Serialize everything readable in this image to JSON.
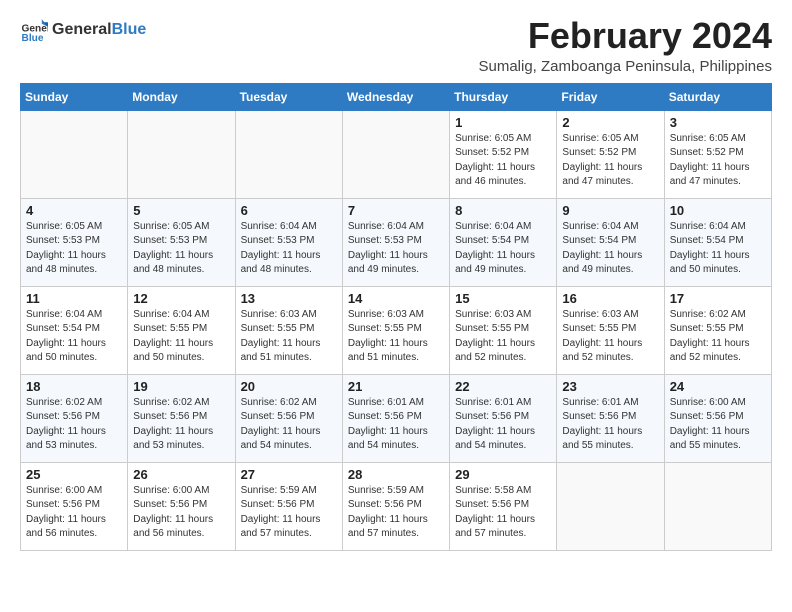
{
  "header": {
    "logo_general": "General",
    "logo_blue": "Blue",
    "month_year": "February 2024",
    "location": "Sumalig, Zamboanga Peninsula, Philippines"
  },
  "weekdays": [
    "Sunday",
    "Monday",
    "Tuesday",
    "Wednesday",
    "Thursday",
    "Friday",
    "Saturday"
  ],
  "weeks": [
    [
      {
        "day": "",
        "info": ""
      },
      {
        "day": "",
        "info": ""
      },
      {
        "day": "",
        "info": ""
      },
      {
        "day": "",
        "info": ""
      },
      {
        "day": "1",
        "info": "Sunrise: 6:05 AM\nSunset: 5:52 PM\nDaylight: 11 hours\nand 46 minutes."
      },
      {
        "day": "2",
        "info": "Sunrise: 6:05 AM\nSunset: 5:52 PM\nDaylight: 11 hours\nand 47 minutes."
      },
      {
        "day": "3",
        "info": "Sunrise: 6:05 AM\nSunset: 5:52 PM\nDaylight: 11 hours\nand 47 minutes."
      }
    ],
    [
      {
        "day": "4",
        "info": "Sunrise: 6:05 AM\nSunset: 5:53 PM\nDaylight: 11 hours\nand 48 minutes."
      },
      {
        "day": "5",
        "info": "Sunrise: 6:05 AM\nSunset: 5:53 PM\nDaylight: 11 hours\nand 48 minutes."
      },
      {
        "day": "6",
        "info": "Sunrise: 6:04 AM\nSunset: 5:53 PM\nDaylight: 11 hours\nand 48 minutes."
      },
      {
        "day": "7",
        "info": "Sunrise: 6:04 AM\nSunset: 5:53 PM\nDaylight: 11 hours\nand 49 minutes."
      },
      {
        "day": "8",
        "info": "Sunrise: 6:04 AM\nSunset: 5:54 PM\nDaylight: 11 hours\nand 49 minutes."
      },
      {
        "day": "9",
        "info": "Sunrise: 6:04 AM\nSunset: 5:54 PM\nDaylight: 11 hours\nand 49 minutes."
      },
      {
        "day": "10",
        "info": "Sunrise: 6:04 AM\nSunset: 5:54 PM\nDaylight: 11 hours\nand 50 minutes."
      }
    ],
    [
      {
        "day": "11",
        "info": "Sunrise: 6:04 AM\nSunset: 5:54 PM\nDaylight: 11 hours\nand 50 minutes."
      },
      {
        "day": "12",
        "info": "Sunrise: 6:04 AM\nSunset: 5:55 PM\nDaylight: 11 hours\nand 50 minutes."
      },
      {
        "day": "13",
        "info": "Sunrise: 6:03 AM\nSunset: 5:55 PM\nDaylight: 11 hours\nand 51 minutes."
      },
      {
        "day": "14",
        "info": "Sunrise: 6:03 AM\nSunset: 5:55 PM\nDaylight: 11 hours\nand 51 minutes."
      },
      {
        "day": "15",
        "info": "Sunrise: 6:03 AM\nSunset: 5:55 PM\nDaylight: 11 hours\nand 52 minutes."
      },
      {
        "day": "16",
        "info": "Sunrise: 6:03 AM\nSunset: 5:55 PM\nDaylight: 11 hours\nand 52 minutes."
      },
      {
        "day": "17",
        "info": "Sunrise: 6:02 AM\nSunset: 5:55 PM\nDaylight: 11 hours\nand 52 minutes."
      }
    ],
    [
      {
        "day": "18",
        "info": "Sunrise: 6:02 AM\nSunset: 5:56 PM\nDaylight: 11 hours\nand 53 minutes."
      },
      {
        "day": "19",
        "info": "Sunrise: 6:02 AM\nSunset: 5:56 PM\nDaylight: 11 hours\nand 53 minutes."
      },
      {
        "day": "20",
        "info": "Sunrise: 6:02 AM\nSunset: 5:56 PM\nDaylight: 11 hours\nand 54 minutes."
      },
      {
        "day": "21",
        "info": "Sunrise: 6:01 AM\nSunset: 5:56 PM\nDaylight: 11 hours\nand 54 minutes."
      },
      {
        "day": "22",
        "info": "Sunrise: 6:01 AM\nSunset: 5:56 PM\nDaylight: 11 hours\nand 54 minutes."
      },
      {
        "day": "23",
        "info": "Sunrise: 6:01 AM\nSunset: 5:56 PM\nDaylight: 11 hours\nand 55 minutes."
      },
      {
        "day": "24",
        "info": "Sunrise: 6:00 AM\nSunset: 5:56 PM\nDaylight: 11 hours\nand 55 minutes."
      }
    ],
    [
      {
        "day": "25",
        "info": "Sunrise: 6:00 AM\nSunset: 5:56 PM\nDaylight: 11 hours\nand 56 minutes."
      },
      {
        "day": "26",
        "info": "Sunrise: 6:00 AM\nSunset: 5:56 PM\nDaylight: 11 hours\nand 56 minutes."
      },
      {
        "day": "27",
        "info": "Sunrise: 5:59 AM\nSunset: 5:56 PM\nDaylight: 11 hours\nand 57 minutes."
      },
      {
        "day": "28",
        "info": "Sunrise: 5:59 AM\nSunset: 5:56 PM\nDaylight: 11 hours\nand 57 minutes."
      },
      {
        "day": "29",
        "info": "Sunrise: 5:58 AM\nSunset: 5:56 PM\nDaylight: 11 hours\nand 57 minutes."
      },
      {
        "day": "",
        "info": ""
      },
      {
        "day": "",
        "info": ""
      }
    ]
  ]
}
